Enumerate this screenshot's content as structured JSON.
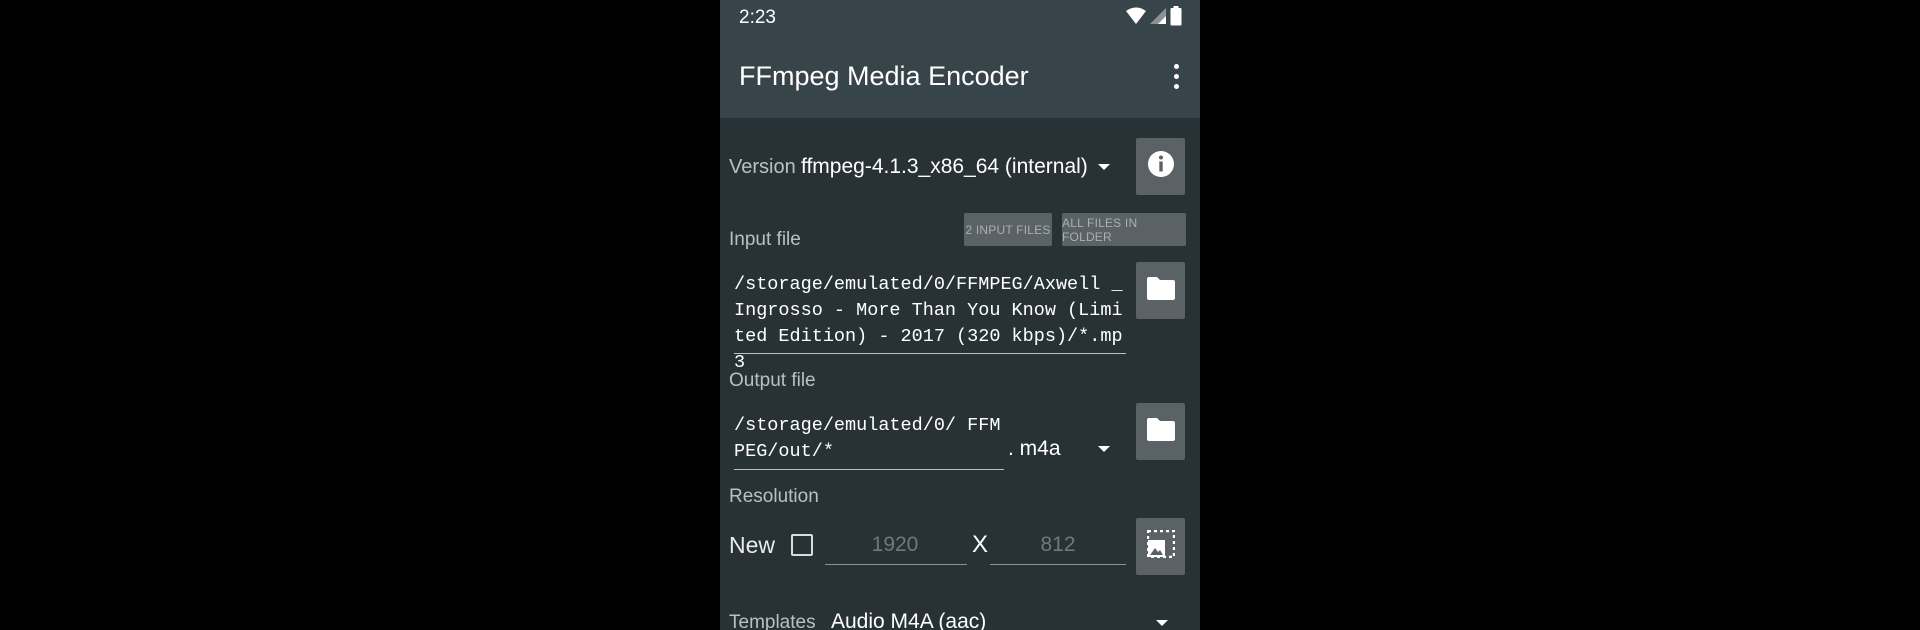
{
  "status_bar": {
    "time": "2:23",
    "icons": [
      "wifi-icon",
      "cell-signal-icon",
      "battery-icon"
    ]
  },
  "app_bar": {
    "title": "FFmpeg Media Encoder",
    "menu_icon": "more-vert-icon"
  },
  "version": {
    "label": "Version",
    "selected": "ffmpeg-4.1.3_x86_64 (internal)",
    "info_icon": "info-icon"
  },
  "input": {
    "label": "Input file",
    "btn_two_inputs": "2 INPUT FILES",
    "btn_all_in_folder": "ALL FILES IN FOLDER",
    "value": "/storage/emulated/0/FFMPEG/Axwell _ Ingrosso - More Than You Know (Limited Edition) - 2017 (320 kbps)/*.mp3",
    "folder_icon": "folder-icon"
  },
  "output": {
    "label": "Output file",
    "value": "/storage/emulated/0/ FFMPEG/out/*",
    "extension": ". m4a",
    "folder_icon": "folder-icon"
  },
  "resolution": {
    "label": "Resolution",
    "new_label": "New",
    "checked": false,
    "width_placeholder": "1920",
    "separator": "X",
    "height_placeholder": "812",
    "icon": "photo-size-select-icon"
  },
  "templates": {
    "label": "Templates",
    "selected": "Audio M4A (aac)"
  },
  "colors": {
    "app_bar": "#37454b",
    "background": "#283236",
    "button": "#5a6266"
  }
}
